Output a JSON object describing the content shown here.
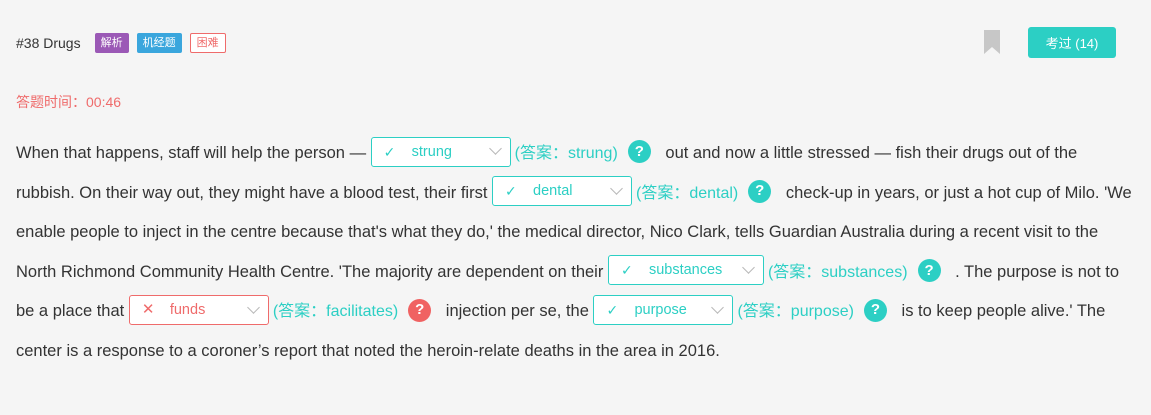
{
  "header": {
    "title": "#38 Drugs",
    "tags": [
      "解析",
      "机经题",
      "困难"
    ],
    "exam_button": "考过 (14)"
  },
  "timer": "答题时间：00:46",
  "colors": {
    "accent": "#2ccfc4",
    "error": "#ef6b6b",
    "purple": "#9b59b6",
    "blue": "#3aa6dd"
  },
  "passage": {
    "t1": "When that happens, staff will help the person — ",
    "b1": {
      "value": "strung",
      "mark": "✓",
      "answer": "(答案：strung)",
      "correct": true
    },
    "t2": " out and now a little stressed — fish their drugs out of the rubbish. On their way out, they might have a blood test, their first ",
    "b2": {
      "value": "dental",
      "mark": "✓",
      "answer": "(答案：dental)",
      "correct": true
    },
    "t3": " check-up in years, or just a hot cup of Milo. 'We enable people to inject in the centre because that's what they do,' the medical director, Nico Clark, tells Guardian Australia during a recent visit to the North Richmond Community Health Centre. 'The majority are dependent on their ",
    "b3": {
      "value": "substances",
      "mark": "✓",
      "answer": "(答案：substances)",
      "correct": true
    },
    "t4": " . The purpose is not to be a place that ",
    "b4": {
      "value": "funds",
      "mark": "✕",
      "answer": "(答案：facilitates)",
      "correct": false
    },
    "t5": " injection per se, the ",
    "b5": {
      "value": "purpose",
      "mark": "✓",
      "answer": "(答案：purpose)",
      "correct": true
    },
    "t6": " is to keep people alive.' The center is a response to a coroner’s report that noted the heroin-relate deaths in the area in 2016.",
    "help_glyph": "?"
  }
}
